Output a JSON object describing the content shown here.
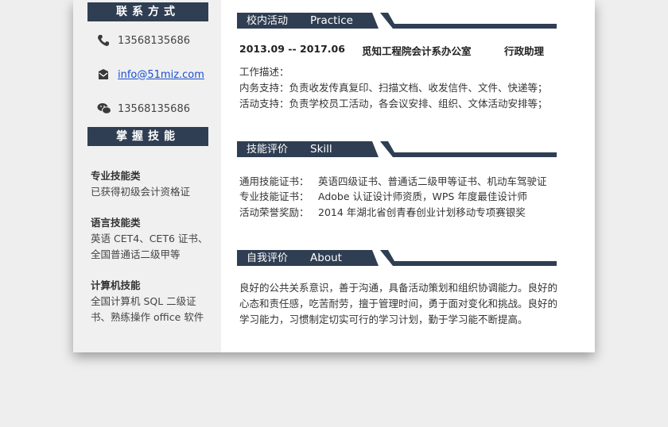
{
  "contact": {
    "header": "联系方式",
    "phone": "13568135686",
    "email": "info@51miz.com",
    "wechat": "13568135686"
  },
  "skills_side": {
    "header": "掌握技能",
    "groups": [
      {
        "title": "专业技能类",
        "lines": [
          "已获得初级会计资格证"
        ]
      },
      {
        "title": "语言技能类",
        "lines": [
          "英语 CET4、CET6 证书、",
          "全国普通话二级甲等"
        ]
      },
      {
        "title": "计算机技能",
        "lines": [
          "全国计算机 SQL 二级证",
          "书、熟练操作 office 软件"
        ]
      }
    ]
  },
  "practice": {
    "title_cn": "校内活动",
    "title_en": "Practice",
    "period": "2013.09 -- 2017.06",
    "org": "觅知工程院会计系办公室",
    "role": "行政助理",
    "lines": [
      "工作描述：",
      "内务支持：负责收发传真复印、扫描文档、收发信件、文件、快递等；",
      "活动支持：负责学校员工活动，各会议安排、组织、文体活动安排等；"
    ]
  },
  "skill": {
    "title_cn": "技能评价",
    "title_en": "Skill",
    "rows": [
      {
        "label": "通用技能证书：",
        "value": "英语四级证书、普通话二级甲等证书、机动车驾驶证"
      },
      {
        "label": "专业技能证书：",
        "value": "Adobe 认证设计师资质，WPS 年度最佳设计师"
      },
      {
        "label": "活动荣誉奖励：",
        "value": "2014 年湖北省创青春创业计划移动专项赛银奖"
      }
    ]
  },
  "about": {
    "title_cn": "自我评价",
    "title_en": "About",
    "lines": [
      "良好的公共关系意识，善于沟通，具备活动策划和组织协调能力。良好的",
      "心态和责任感，吃苦耐劳，擅于管理时间，勇于面对变化和挑战。良好的",
      "学习能力，习惯制定切实可行的学习计划，勤于学习能不断提高。"
    ]
  },
  "colors": {
    "accent": "#2f3e52",
    "sidebar_bg": "#f0f0f0"
  },
  "icons": [
    "phone-icon",
    "mail-icon",
    "wechat-icon"
  ]
}
